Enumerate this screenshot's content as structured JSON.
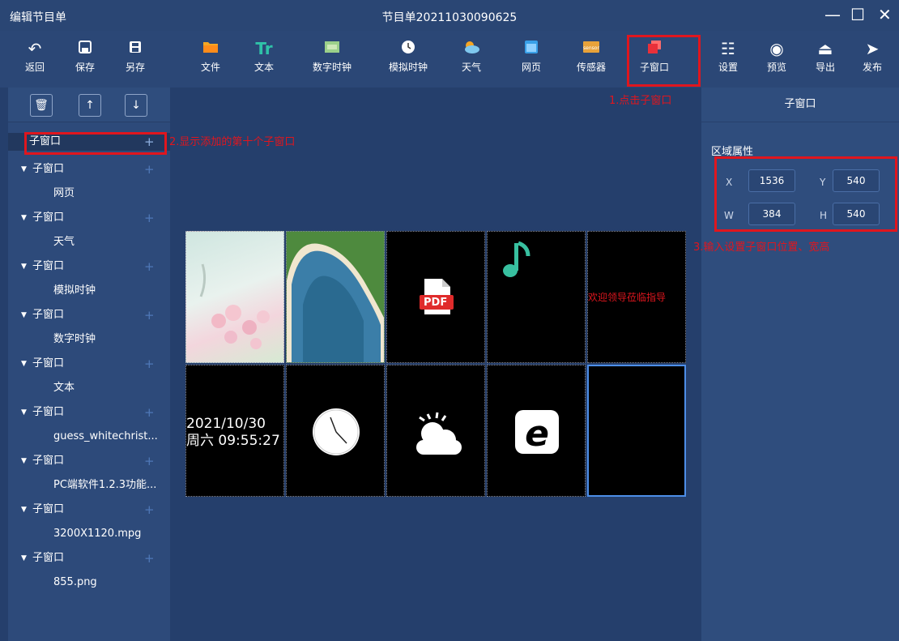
{
  "titlebar": {
    "app_title": "编辑节目单",
    "doc_title": "节目单20211030090625",
    "minimize": "—",
    "maximize": "☐",
    "close": "✕"
  },
  "toolbar": {
    "back": "返回",
    "save": "保存",
    "save_as": "另存",
    "file": "文件",
    "text": "文本",
    "digital_clock": "数字时钟",
    "analog_clock": "模拟时钟",
    "weather": "天气",
    "webpage": "网页",
    "sensor": "传感器",
    "subwindow": "子窗口",
    "settings": "设置",
    "preview": "预览",
    "export": "导出",
    "publish": "发布"
  },
  "left_panel": {
    "tree": [
      {
        "label": "子窗口",
        "selected": true
      },
      {
        "label": "子窗口",
        "child": "网页"
      },
      {
        "label": "子窗口",
        "child": "天气"
      },
      {
        "label": "子窗口",
        "child": "模拟时钟"
      },
      {
        "label": "子窗口",
        "child": "数字时钟"
      },
      {
        "label": "子窗口",
        "child": "文本"
      },
      {
        "label": "子窗口",
        "child": "guess_whitechrist..."
      },
      {
        "label": "子窗口",
        "child": "PC端软件1.2.3功能..."
      },
      {
        "label": "子窗口",
        "child": "3200X1120.mpg"
      },
      {
        "label": "子窗口",
        "child": "855.png"
      }
    ]
  },
  "canvas": {
    "welcome_text": "欢迎领导莅临指导",
    "pdf_label": "PDF",
    "datetime_line1": "2021/10/30",
    "datetime_line2": "周六 09:55:27"
  },
  "right_panel": {
    "title": "子窗口",
    "section": "区域属性",
    "x_label": "X",
    "x_value": "1536",
    "y_label": "Y",
    "y_value": "540",
    "w_label": "W",
    "w_value": "384",
    "h_label": "H",
    "h_value": "540"
  },
  "annotations": {
    "step1": "1.点击子窗口",
    "step2": "2.显示添加的第十个子窗口",
    "step3": "3.输入设置子窗口位置、宽高"
  },
  "colors": {
    "accent": "#e0161e",
    "panel": "#2d4a7a",
    "selected_border": "#4d8ee8"
  }
}
